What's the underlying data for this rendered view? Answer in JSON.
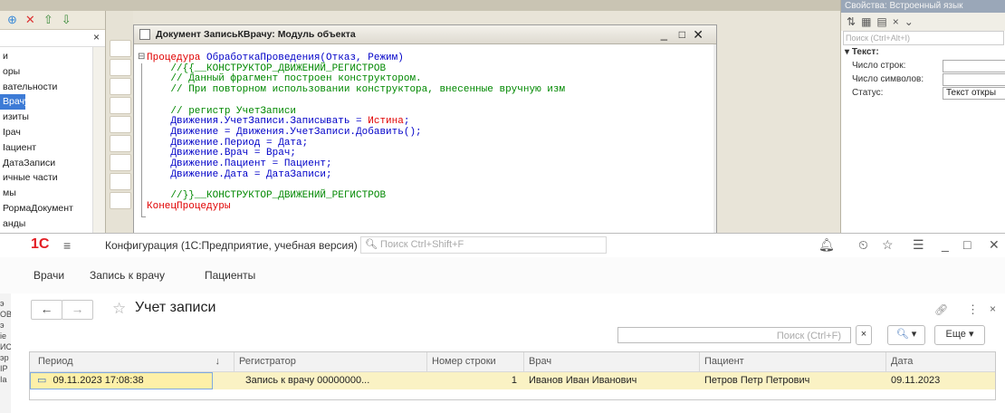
{
  "left_panel": {
    "toolbar_icons": [
      "add-icon",
      "delete-icon",
      "move-up-icon",
      "move-down-icon"
    ],
    "items": [
      "и",
      "оры",
      "вательности",
      "Врачу",
      "изиты",
      "Ірач",
      "Іациент",
      "ДатаЗаписи",
      "ичные части",
      "мы",
      "РормаДокумент",
      "анды"
    ],
    "selected_index": 3
  },
  "code_window": {
    "title": "Документ ЗаписьКВрачу: Модуль объекта",
    "lines": [
      {
        "segments": [
          {
            "t": "Процедура ",
            "c": "kw"
          },
          {
            "t": "ОбработкаПроведения(Отказ, Режим)",
            "c": "tx"
          }
        ]
      },
      {
        "segments": [
          {
            "t": "    //{{__КОНСТРУКТОР_ДВИЖЕНИЙ_РЕГИСТРОВ",
            "c": "cm"
          }
        ]
      },
      {
        "segments": [
          {
            "t": "    // Данный фрагмент построен конструктором.",
            "c": "cm"
          }
        ]
      },
      {
        "segments": [
          {
            "t": "    // При повторном использовании конструктора, внесенные вручную изм",
            "c": "cm"
          }
        ]
      },
      {
        "segments": []
      },
      {
        "segments": [
          {
            "t": "    // регистр УчетЗаписи",
            "c": "cm"
          }
        ]
      },
      {
        "segments": [
          {
            "t": "    Движения.УчетЗаписи.Записывать = ",
            "c": "tx"
          },
          {
            "t": "Истина",
            "c": "kw"
          },
          {
            "t": ";",
            "c": "tx"
          }
        ]
      },
      {
        "segments": [
          {
            "t": "    Движение = Движения.УчетЗаписи.Добавить();",
            "c": "tx"
          }
        ]
      },
      {
        "segments": [
          {
            "t": "    Движение.Период = Дата;",
            "c": "tx"
          }
        ]
      },
      {
        "segments": [
          {
            "t": "    Движение.Врач = Врач;",
            "c": "tx"
          }
        ]
      },
      {
        "segments": [
          {
            "t": "    Движение.Пациент = Пациент;",
            "c": "tx"
          }
        ]
      },
      {
        "segments": [
          {
            "t": "    Движение.Дата = ДатаЗаписи;",
            "c": "tx"
          }
        ]
      },
      {
        "segments": []
      },
      {
        "segments": [
          {
            "t": "    //}}__КОНСТРУКТОР_ДВИЖЕНИЙ_РЕГИСТРОВ",
            "c": "cm"
          }
        ]
      },
      {
        "segments": [
          {
            "t": "КонецПроцедуры",
            "c": "kw"
          }
        ]
      }
    ]
  },
  "props_panel": {
    "title": "Свойства: Встроенный язык",
    "search_placeholder": "Поиск (Ctrl+Alt+I)",
    "section": "Текст:",
    "rows": [
      {
        "label": "Число строк:",
        "value": ""
      },
      {
        "label": "Число символов:",
        "value": ""
      },
      {
        "label": "Статус:",
        "value": "Текст откры"
      }
    ]
  },
  "app": {
    "logo": "1С",
    "title": "Конфигурация  (1С:Предприятие, учебная версия)",
    "global_search_placeholder": "Поиск Ctrl+Shift+F",
    "menu": [
      "Врачи",
      "Запись к врачу",
      "Пациенты"
    ],
    "form_title": "Учет записи",
    "search_placeholder": "Поиск (Ctrl+F)",
    "clear_label": "×",
    "find_label": "▾",
    "more_label": "Еще ▾",
    "columns": [
      {
        "label": "Период",
        "sort": "↓"
      },
      {
        "label": "Регистратор"
      },
      {
        "label": "Номер строки"
      },
      {
        "label": "Врач"
      },
      {
        "label": "Пациент"
      },
      {
        "label": "Дата"
      }
    ],
    "rows": [
      {
        "period": "09.11.2023 17:08:38",
        "registrar": "Запись к врачу 00000000...",
        "line": "1",
        "doctor": "Иванов Иван Иванович",
        "patient": "Петров Петр Петрович",
        "date": "09.11.2023"
      }
    ]
  },
  "left_cut_labels": [
    "ІЭ",
    "К",
    "ИЯ",
    "э",
    "ОВ",
    "э",
    "іе",
    "ИС",
    "эр",
    "ІР",
    "Іа"
  ],
  "colors": {
    "logo": "#e31e24",
    "keyword": "#e00000",
    "comment": "#008800",
    "text": "#0000c8",
    "selection": "#3d7bd6",
    "row_highlight": "#faf2c4"
  }
}
